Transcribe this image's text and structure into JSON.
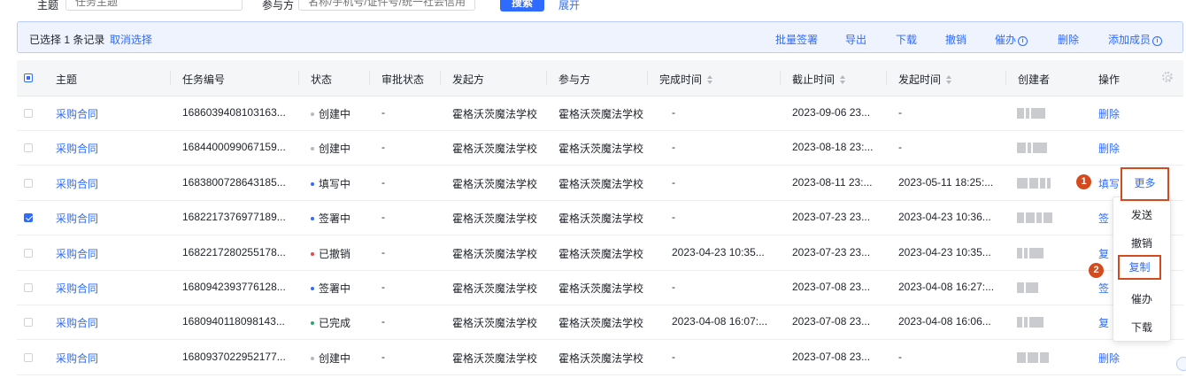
{
  "filters": {
    "subject_label": "主题",
    "subject_placeholder": "任务主题",
    "participant_label": "参与方",
    "participant_placeholder": "名称/手机号/证件号/统一社会信用",
    "search_label": "搜索",
    "expand_label": "展开"
  },
  "selection": {
    "text": "已选择 1 条记录",
    "cancel": "取消选择",
    "actions": [
      "批量签署",
      "导出",
      "下载",
      "撤销",
      "催办",
      "删除",
      "添加成员"
    ]
  },
  "columns": [
    "主题",
    "任务编号",
    "状态",
    "审批状态",
    "发起方",
    "参与方",
    "完成时间",
    "截止时间",
    "发起时间",
    "创建者",
    "操作"
  ],
  "status_colors": {
    "创建中": "#b5b8bd",
    "填写中": "#2f6bff",
    "签署中": "#2f6bff",
    "已撤销": "#e5484d",
    "已完成": "#2fa56b"
  },
  "rows": [
    {
      "subject": "采购合同",
      "id": "1686039408103163...",
      "status": "创建中",
      "approval": "-",
      "initiator": "霍格沃茨魔法学校",
      "participant": "霍格沃茨魔法学校",
      "completed": "-",
      "deadline": "2023-09-06 23...",
      "started": "-",
      "action": "删除",
      "checked": false
    },
    {
      "subject": "采购合同",
      "id": "1684400099067159...",
      "status": "创建中",
      "approval": "-",
      "initiator": "霍格沃茨魔法学校",
      "participant": "霍格沃茨魔法学校",
      "completed": "-",
      "deadline": "2023-08-18 23:...",
      "started": "-",
      "action": "删除",
      "checked": false
    },
    {
      "subject": "采购合同",
      "id": "1683800728643185...",
      "status": "填写中",
      "approval": "-",
      "initiator": "霍格沃茨魔法学校",
      "participant": "霍格沃茨魔法学校",
      "completed": "-",
      "deadline": "2023-08-11 23:...",
      "started": "2023-05-11 18:25:...",
      "action": "填写",
      "checked": false
    },
    {
      "subject": "采购合同",
      "id": "1682217376977189...",
      "status": "签署中",
      "approval": "-",
      "initiator": "霍格沃茨魔法学校",
      "participant": "霍格沃茨魔法学校",
      "completed": "-",
      "deadline": "2023-07-23 23...",
      "started": "2023-04-23 10:36...",
      "action": "签",
      "checked": true
    },
    {
      "subject": "采购合同",
      "id": "1682217280255178...",
      "status": "已撤销",
      "approval": "-",
      "initiator": "霍格沃茨魔法学校",
      "participant": "霍格沃茨魔法学校",
      "completed": "2023-04-23 10:35...",
      "deadline": "2023-07-23 23...",
      "started": "2023-04-23 10:35...",
      "action": "复",
      "checked": false
    },
    {
      "subject": "采购合同",
      "id": "1680942393776128...",
      "status": "签署中",
      "approval": "-",
      "initiator": "霍格沃茨魔法学校",
      "participant": "霍格沃茨魔法学校",
      "completed": "-",
      "deadline": "2023-07-08 23...",
      "started": "2023-04-08 16:27:...",
      "action": "签",
      "checked": false
    },
    {
      "subject": "采购合同",
      "id": "1680940118098143...",
      "status": "已完成",
      "approval": "-",
      "initiator": "霍格沃茨魔法学校",
      "participant": "霍格沃茨魔法学校",
      "completed": "2023-04-08 16:07:...",
      "deadline": "2023-07-08 23...",
      "started": "2023-04-08 16:06...",
      "action": "复",
      "checked": false
    },
    {
      "subject": "采购合同",
      "id": "1680937022952177...",
      "status": "创建中",
      "approval": "-",
      "initiator": "霍格沃茨魔法学校",
      "participant": "霍格沃茨魔法学校",
      "completed": "-",
      "deadline": "2023-07-08 23...",
      "started": "-",
      "action": "删除",
      "checked": false
    }
  ],
  "more_button": "更多",
  "dropdown": [
    "发送",
    "撤销",
    "复制",
    "催办",
    "下载"
  ],
  "annotations": [
    "1",
    "2"
  ]
}
